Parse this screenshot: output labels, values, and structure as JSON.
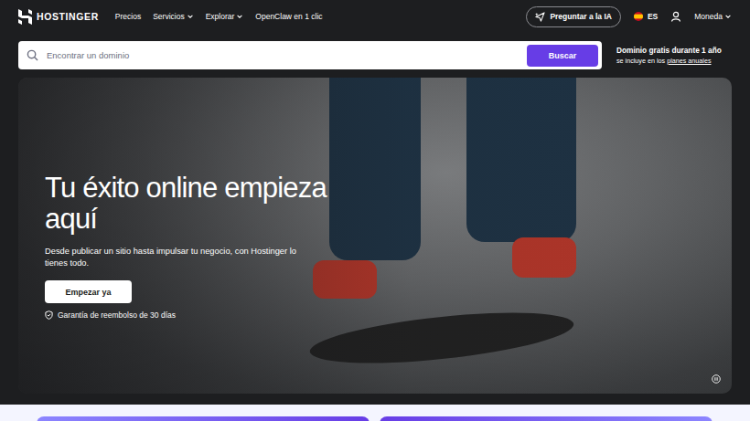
{
  "nav": {
    "logo": "HOSTINGER",
    "links": [
      {
        "label": "Precios",
        "has_menu": false
      },
      {
        "label": "Servicios",
        "has_menu": true
      },
      {
        "label": "Explorar",
        "has_menu": true
      },
      {
        "label": "OpenClaw en 1 clic",
        "has_menu": false
      }
    ],
    "ai_button": "Preguntar a la IA",
    "language": "ES",
    "currency": {
      "label": "Moneda",
      "has_menu": true
    }
  },
  "search": {
    "placeholder": "Encontrar un dominio",
    "button": "Buscar"
  },
  "promo": {
    "title": "Dominio gratis durante 1 año",
    "text": "se incluye en los",
    "link": "planes anuales"
  },
  "hero": {
    "title": "Tu éxito online empieza aquí",
    "subtitle": "Desde publicar un sitio hasta impulsar tu negocio, con Hostinger lo tienes todo.",
    "cta": "Empezar ya",
    "guarantee": "Garantía de reembolso de 30 días"
  }
}
